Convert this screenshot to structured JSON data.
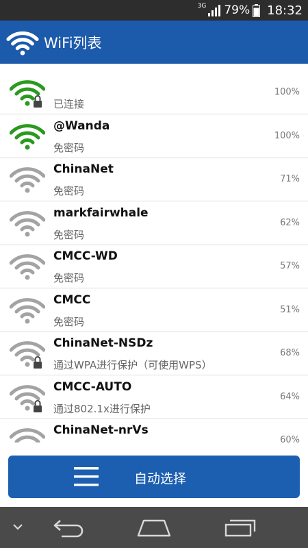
{
  "status_bar": {
    "network_type": "3G",
    "battery_percent": "79%",
    "time": "18:32"
  },
  "header": {
    "title": "WiFi列表",
    "icon": "wifi-icon"
  },
  "wifi_list": [
    {
      "name": "",
      "status": "已连接",
      "percent": "100%",
      "signal_color": "green",
      "locked": true
    },
    {
      "name": "@Wanda",
      "status": "免密码",
      "percent": "100%",
      "signal_color": "green",
      "locked": false
    },
    {
      "name": "ChinaNet",
      "status": "免密码",
      "percent": "71%",
      "signal_color": "gray",
      "locked": false
    },
    {
      "name": "markfairwhale",
      "status": "免密码",
      "percent": "62%",
      "signal_color": "gray",
      "locked": false
    },
    {
      "name": "CMCC-WD",
      "status": "免密码",
      "percent": "57%",
      "signal_color": "gray",
      "locked": false
    },
    {
      "name": "CMCC",
      "status": "免密码",
      "percent": "51%",
      "signal_color": "gray",
      "locked": false
    },
    {
      "name": "ChinaNet-NSDz",
      "status": "通过WPA进行保护（可使用WPS）",
      "percent": "68%",
      "signal_color": "gray",
      "locked": true
    },
    {
      "name": "CMCC-AUTO",
      "status": "通过802.1x进行保护",
      "percent": "64%",
      "signal_color": "gray",
      "locked": true
    },
    {
      "name": "ChinaNet-nrVs",
      "status": "",
      "percent": "60%",
      "signal_color": "gray",
      "locked": false
    }
  ],
  "auto_select": {
    "label": "自动选择",
    "icon": "menu-icon"
  },
  "nav_bar": {
    "icons": [
      "chevron-down-icon",
      "back-icon",
      "home-icon",
      "recents-icon"
    ]
  },
  "colors": {
    "header_bg": "#1c5aab",
    "button_bg": "#1c5fb0",
    "signal_green": "#2a9a1e",
    "signal_gray": "#a3a3a3",
    "nav_bg": "#4a4a4a"
  }
}
